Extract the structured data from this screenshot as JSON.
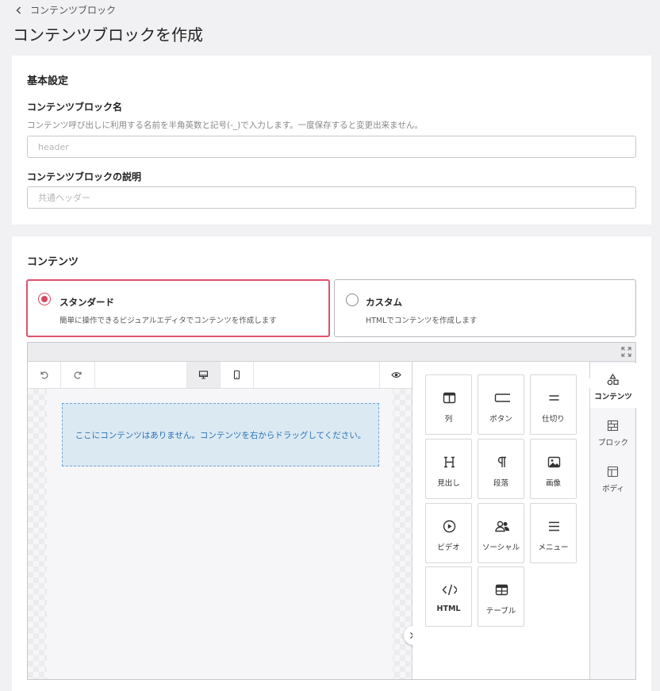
{
  "breadcrumb": {
    "label": "コンテンツブロック"
  },
  "page": {
    "title": "コンテンツブロックを作成"
  },
  "basic": {
    "title": "基本設定",
    "name_label": "コンテンツブロック名",
    "name_help": "コンテンツ呼び出しに利用する名前を半角英数と記号(-_)で入力します。一度保存すると変更出来ません。",
    "name_placeholder": "header",
    "desc_label": "コンテンツブロックの説明",
    "desc_placeholder": "共通ヘッダー"
  },
  "content": {
    "title": "コンテンツ",
    "options": [
      {
        "title": "スタンダード",
        "desc": "簡単に操作できるビジュアルエディタでコンテンツを作成します",
        "selected": true
      },
      {
        "title": "カスタム",
        "desc": "HTMLでコンテンツを作成します",
        "selected": false
      }
    ]
  },
  "editor": {
    "empty_message": "ここにコンテンツはありません。コンテンツを右からドラッグしてください。",
    "tools": [
      {
        "label": "列",
        "icon": "columns-icon"
      },
      {
        "label": "ボタン",
        "icon": "button-icon"
      },
      {
        "label": "仕切り",
        "icon": "divider-icon"
      },
      {
        "label": "見出し",
        "icon": "heading-icon"
      },
      {
        "label": "段落",
        "icon": "paragraph-icon"
      },
      {
        "label": "画像",
        "icon": "image-icon"
      },
      {
        "label": "ビデオ",
        "icon": "video-icon"
      },
      {
        "label": "ソーシャル",
        "icon": "social-icon"
      },
      {
        "label": "メニュー",
        "icon": "menu-icon"
      },
      {
        "label": "HTML",
        "icon": "code-icon"
      },
      {
        "label": "テーブル",
        "icon": "table-icon"
      }
    ],
    "side_tabs": [
      {
        "label": "コンテンツ",
        "icon": "shapes-icon",
        "active": true
      },
      {
        "label": "ブロック",
        "icon": "blocks-icon",
        "active": false
      },
      {
        "label": "ボディ",
        "icon": "layout-icon",
        "active": false
      }
    ]
  },
  "colors": {
    "accent": "#d9455f",
    "dropzone_text": "#2d72b5",
    "dropzone_bg": "#dbe9f3"
  }
}
